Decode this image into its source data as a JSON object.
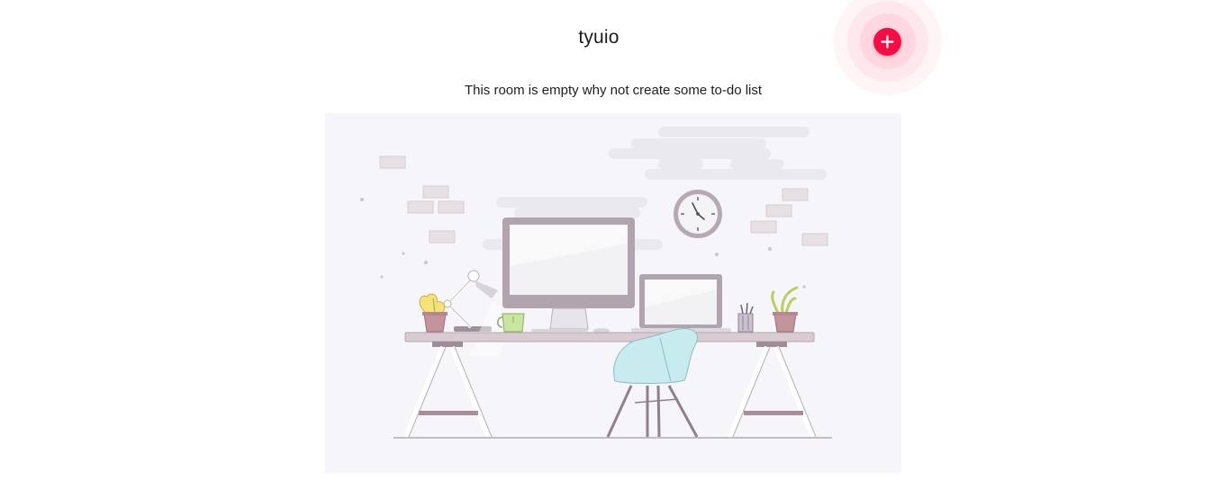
{
  "room": {
    "title": "tyuio"
  },
  "add_button": {
    "icon": "plus-icon",
    "accent_color": "#f20f45"
  },
  "empty_state": {
    "message": "This room is empty why not create some to-do list",
    "illustration": "desk-workspace-illustration"
  }
}
